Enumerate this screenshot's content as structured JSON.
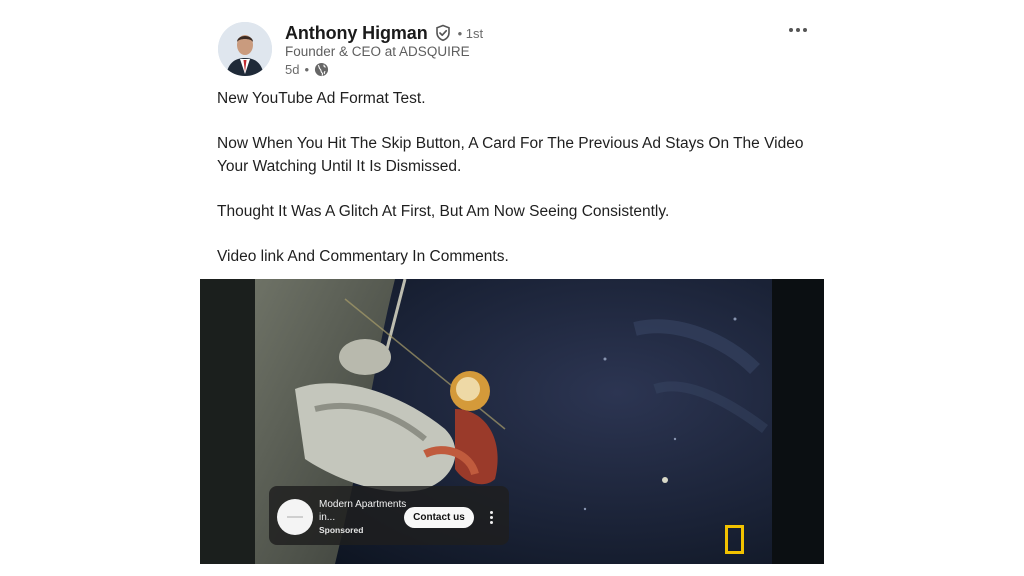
{
  "post": {
    "author": {
      "name": "Anthony Higman",
      "degree": "• 1st",
      "headline": "Founder & CEO at ADSQUIRE",
      "time": "5d",
      "time_separator": "•"
    },
    "body": [
      "New YouTube Ad Format Test.",
      "",
      "Now When You Hit The Skip Button, A Card For The Previous Ad Stays On The Video Your Watching Until It Is Dismissed.",
      "",
      "Thought It Was A Glitch At First, But Am Now Seeing Consistently.",
      "",
      "Video link And Commentary In Comments."
    ]
  },
  "video": {
    "ad_card": {
      "title": "Modern Apartments in...",
      "sponsored": "Sponsored",
      "cta": "Contact us"
    }
  },
  "icons": {
    "verified": "shield-check-icon",
    "visibility": "globe-icon",
    "more": "ellipsis-icon",
    "ad_menu": "vertical-ellipsis-icon",
    "watermark": "national-geographic-logo"
  },
  "colors": {
    "watermark_yellow": "#f2c200",
    "text_primary": "#1f1f1f",
    "text_secondary": "#5e5e5e"
  }
}
